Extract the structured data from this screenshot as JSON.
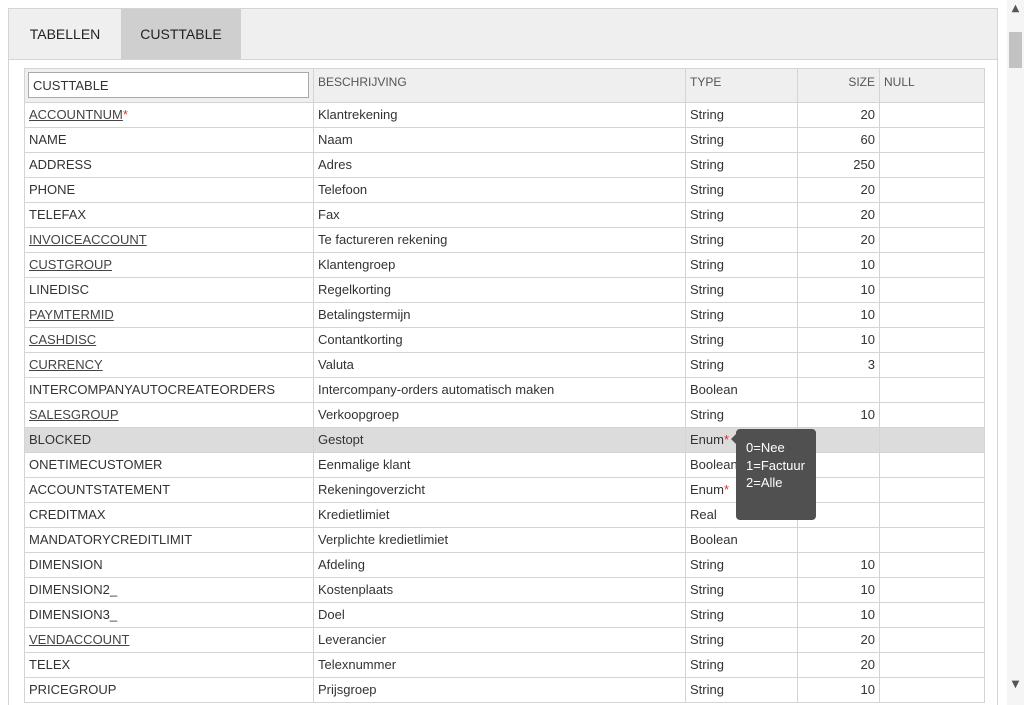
{
  "tabs": [
    {
      "label": "TABELLEN",
      "active": false
    },
    {
      "label": "CUSTTABLE",
      "active": true
    }
  ],
  "grid": {
    "filter_value": "CUSTTABLE",
    "headers": {
      "description": "BESCHRIJVING",
      "type": "TYPE",
      "size": "SIZE",
      "null": "NULL"
    },
    "rows": [
      {
        "name": "ACCOUNTNUM",
        "link": true,
        "required": true,
        "description": "Klantrekening",
        "type": "String",
        "type_required": false,
        "size": "20",
        "null": "",
        "selected": false
      },
      {
        "name": "NAME",
        "link": false,
        "required": false,
        "description": "Naam",
        "type": "String",
        "type_required": false,
        "size": "60",
        "null": "",
        "selected": false
      },
      {
        "name": "ADDRESS",
        "link": false,
        "required": false,
        "description": "Adres",
        "type": "String",
        "type_required": false,
        "size": "250",
        "null": "",
        "selected": false
      },
      {
        "name": "PHONE",
        "link": false,
        "required": false,
        "description": "Telefoon",
        "type": "String",
        "type_required": false,
        "size": "20",
        "null": "",
        "selected": false
      },
      {
        "name": "TELEFAX",
        "link": false,
        "required": false,
        "description": "Fax",
        "type": "String",
        "type_required": false,
        "size": "20",
        "null": "",
        "selected": false
      },
      {
        "name": "INVOICEACCOUNT",
        "link": true,
        "required": false,
        "description": "Te factureren rekening",
        "type": "String",
        "type_required": false,
        "size": "20",
        "null": "",
        "selected": false
      },
      {
        "name": "CUSTGROUP",
        "link": true,
        "required": false,
        "description": "Klantengroep",
        "type": "String",
        "type_required": false,
        "size": "10",
        "null": "",
        "selected": false
      },
      {
        "name": "LINEDISC",
        "link": false,
        "required": false,
        "description": "Regelkorting",
        "type": "String",
        "type_required": false,
        "size": "10",
        "null": "",
        "selected": false
      },
      {
        "name": "PAYMTERMID",
        "link": true,
        "required": false,
        "description": "Betalingstermijn",
        "type": "String",
        "type_required": false,
        "size": "10",
        "null": "",
        "selected": false
      },
      {
        "name": "CASHDISC",
        "link": true,
        "required": false,
        "description": "Contantkorting",
        "type": "String",
        "type_required": false,
        "size": "10",
        "null": "",
        "selected": false
      },
      {
        "name": "CURRENCY",
        "link": true,
        "required": false,
        "description": "Valuta",
        "type": "String",
        "type_required": false,
        "size": "3",
        "null": "",
        "selected": false
      },
      {
        "name": "INTERCOMPANYAUTOCREATEORDERS",
        "link": false,
        "required": false,
        "description": "Intercompany-orders automatisch maken",
        "type": "Boolean",
        "type_required": false,
        "size": "",
        "null": "",
        "selected": false
      },
      {
        "name": "SALESGROUP",
        "link": true,
        "required": false,
        "description": "Verkoopgroep",
        "type": "String",
        "type_required": false,
        "size": "10",
        "null": "",
        "selected": false
      },
      {
        "name": "BLOCKED",
        "link": false,
        "required": false,
        "description": "Gestopt",
        "type": "Enum",
        "type_required": true,
        "size": "",
        "null": "",
        "selected": true
      },
      {
        "name": "ONETIMECUSTOMER",
        "link": false,
        "required": false,
        "description": "Eenmalige klant",
        "type": "Boolean",
        "type_required": false,
        "size": "",
        "null": "",
        "selected": false
      },
      {
        "name": "ACCOUNTSTATEMENT",
        "link": false,
        "required": false,
        "description": "Rekeningoverzicht",
        "type": "Enum",
        "type_required": true,
        "size": "",
        "null": "",
        "selected": false
      },
      {
        "name": "CREDITMAX",
        "link": false,
        "required": false,
        "description": "Kredietlimiet",
        "type": "Real",
        "type_required": false,
        "size": "",
        "null": "",
        "selected": false
      },
      {
        "name": "MANDATORYCREDITLIMIT",
        "link": false,
        "required": false,
        "description": "Verplichte kredietlimiet",
        "type": "Boolean",
        "type_required": false,
        "size": "",
        "null": "",
        "selected": false
      },
      {
        "name": "DIMENSION",
        "link": false,
        "required": false,
        "description": "Afdeling",
        "type": "String",
        "type_required": false,
        "size": "10",
        "null": "",
        "selected": false
      },
      {
        "name": "DIMENSION2_",
        "link": false,
        "required": false,
        "description": "Kostenplaats",
        "type": "String",
        "type_required": false,
        "size": "10",
        "null": "",
        "selected": false
      },
      {
        "name": "DIMENSION3_",
        "link": false,
        "required": false,
        "description": "Doel",
        "type": "String",
        "type_required": false,
        "size": "10",
        "null": "",
        "selected": false
      },
      {
        "name": "VENDACCOUNT",
        "link": true,
        "required": false,
        "description": "Leverancier",
        "type": "String",
        "type_required": false,
        "size": "20",
        "null": "",
        "selected": false
      },
      {
        "name": "TELEX",
        "link": false,
        "required": false,
        "description": "Telexnummer",
        "type": "String",
        "type_required": false,
        "size": "20",
        "null": "",
        "selected": false
      },
      {
        "name": "PRICEGROUP",
        "link": false,
        "required": false,
        "description": "Prijsgroep",
        "type": "String",
        "type_required": false,
        "size": "10",
        "null": "",
        "selected": false
      }
    ],
    "required_marker": "*"
  },
  "tooltip": {
    "lines": [
      "0=Nee",
      "1=Factuur",
      "2=Alle"
    ]
  },
  "scrollbar": {
    "up_icon": "chevron-up-icon",
    "down_icon": "chevron-down-icon"
  }
}
